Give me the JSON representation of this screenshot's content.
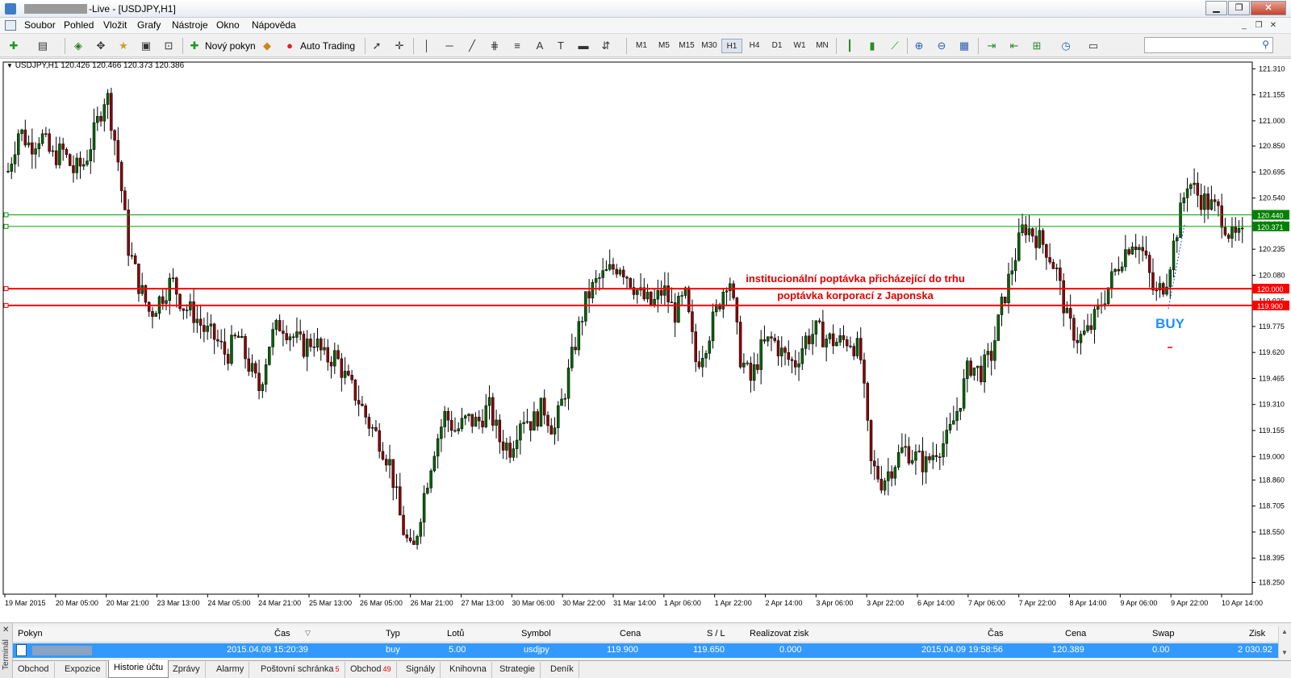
{
  "window": {
    "title": "-Live - [USDJPY,H1]",
    "buttons": [
      "▁",
      "❐",
      "✕"
    ]
  },
  "menu": {
    "items": [
      "Soubor",
      "Pohled",
      "Vložit",
      "Grafy",
      "Nástroje",
      "Okno",
      "Nápověda"
    ],
    "mdi_controls": [
      "_",
      "❐",
      "✕"
    ]
  },
  "toolbar": {
    "new_order": "Nový pokyn",
    "auto_trading": "Auto Trading",
    "timeframes": [
      "M1",
      "M5",
      "M15",
      "M30",
      "H1",
      "H4",
      "D1",
      "W1",
      "MN"
    ],
    "active_timeframe": "H1",
    "tool_a": "A"
  },
  "chart": {
    "header": "USDJPY,H1  120.426 120.466 120.373 120.386",
    "colors": {
      "bull": "#006400",
      "bear": "#8b0000",
      "wick": "#000000",
      "resistance": "#ff0000",
      "support_green": "#00a000"
    }
  },
  "chart_data": {
    "type": "candlestick",
    "symbol": "USDJPY",
    "timeframe": "H1",
    "ylim": [
      118.18,
      121.35
    ],
    "y_ticks": [
      "121.310",
      "121.155",
      "121.000",
      "120.850",
      "120.695",
      "120.540",
      "120.385",
      "120.235",
      "120.080",
      "119.925",
      "119.775",
      "119.620",
      "119.465",
      "119.310",
      "119.155",
      "119.000",
      "118.860",
      "118.705",
      "118.550",
      "118.395",
      "118.250"
    ],
    "x_ticks": [
      "19 Mar 2015",
      "20 Mar 05:00",
      "20 Mar 21:00",
      "23 Mar 13:00",
      "24 Mar 05:00",
      "24 Mar 21:00",
      "25 Mar 13:00",
      "26 Mar 05:00",
      "26 Mar 21:00",
      "27 Mar 13:00",
      "30 Mar 06:00",
      "30 Mar 22:00",
      "31 Mar 14:00",
      "1 Apr 06:00",
      "1 Apr 22:00",
      "2 Apr 14:00",
      "3 Apr 06:00",
      "3 Apr 22:00",
      "6 Apr 14:00",
      "7 Apr 06:00",
      "7 Apr 22:00",
      "8 Apr 14:00",
      "9 Apr 06:00",
      "9 Apr 22:00",
      "10 Apr 14:00"
    ],
    "close_path": [
      120.7,
      120.95,
      120.85,
      120.92,
      120.78,
      120.82,
      120.7,
      120.75,
      120.95,
      121.18,
      120.8,
      120.25,
      120.02,
      119.85,
      119.95,
      120.05,
      119.9,
      119.85,
      119.75,
      119.7,
      119.6,
      119.72,
      119.55,
      119.4,
      119.7,
      119.8,
      119.72,
      119.65,
      119.7,
      119.58,
      119.6,
      119.45,
      119.35,
      119.2,
      119.1,
      118.95,
      118.6,
      118.4,
      118.75,
      119.05,
      119.25,
      119.15,
      119.22,
      119.2,
      119.3,
      119.1,
      119.05,
      119.25,
      119.2,
      119.3,
      119.15,
      119.4,
      119.7,
      119.95,
      120.05,
      120.1,
      120.15,
      120.05,
      119.95,
      119.9,
      120.0,
      119.85,
      119.95,
      119.55,
      119.7,
      119.9,
      120.1,
      119.6,
      119.45,
      119.65,
      119.7,
      119.6,
      119.55,
      119.7,
      119.75,
      119.7,
      119.68,
      119.7,
      119.62,
      118.95,
      118.85,
      118.95,
      119.05,
      119.0,
      118.95,
      119.05,
      119.1,
      119.3,
      119.55,
      119.5,
      119.6,
      119.9,
      120.15,
      120.38,
      120.32,
      120.25,
      120.1,
      119.8,
      119.7,
      119.75,
      119.9,
      120.05,
      120.2,
      120.3,
      120.2,
      119.95,
      120.05,
      120.35,
      120.65,
      120.55,
      120.5,
      120.45,
      120.3,
      120.3
    ],
    "levels": [
      {
        "value": 120.44,
        "label": "120.440",
        "color": "#00a000",
        "style": "green"
      },
      {
        "value": 120.371,
        "label": "120.371",
        "color": "#00a000",
        "style": "green"
      },
      {
        "value": 120.0,
        "label": "120.000",
        "color": "#ff0000",
        "style": "red"
      },
      {
        "value": 119.9,
        "label": "119.900",
        "color": "#ff0000",
        "style": "red"
      }
    ],
    "annotations": [
      {
        "text": "institucionální poptávka přicházející do trhu",
        "color": "#e00000"
      },
      {
        "text": "poptávka korporací z Japonska",
        "color": "#e00000"
      },
      {
        "text": "BUY",
        "color": "#1e90ff"
      }
    ]
  },
  "terminal": {
    "side_label": "Terminál",
    "columns": [
      "Pokyn",
      "Čas",
      "Typ",
      "Lotů",
      "Symbol",
      "Cena",
      "S / L",
      "Realizovat zisk",
      "Čas",
      "Cena",
      "Swap",
      "Zisk"
    ],
    "row": {
      "open_time": "2015.04.09 15:20:39",
      "type": "buy",
      "lots": "5.00",
      "symbol": "usdjpy",
      "open_price": "119.900",
      "sl": "119.650",
      "tp": "0.000",
      "close_time": "2015.04.09 19:58:56",
      "close_price": "120.389",
      "swap": "0.00",
      "profit": "2 030.92"
    },
    "tabs": [
      {
        "label": "Obchod",
        "badge": ""
      },
      {
        "label": "Expozice",
        "badge": ""
      },
      {
        "label": "Historie účtu",
        "badge": ""
      },
      {
        "label": "Zprávy",
        "badge": ""
      },
      {
        "label": "Alarmy",
        "badge": ""
      },
      {
        "label": "Poštovní schránka",
        "badge": "5"
      },
      {
        "label": "Obchod",
        "badge": "49"
      },
      {
        "label": "Signály",
        "badge": ""
      },
      {
        "label": "Knihovna",
        "badge": ""
      },
      {
        "label": "Strategie",
        "badge": ""
      },
      {
        "label": "Deník",
        "badge": ""
      }
    ],
    "active_tab": "Historie účtu"
  }
}
